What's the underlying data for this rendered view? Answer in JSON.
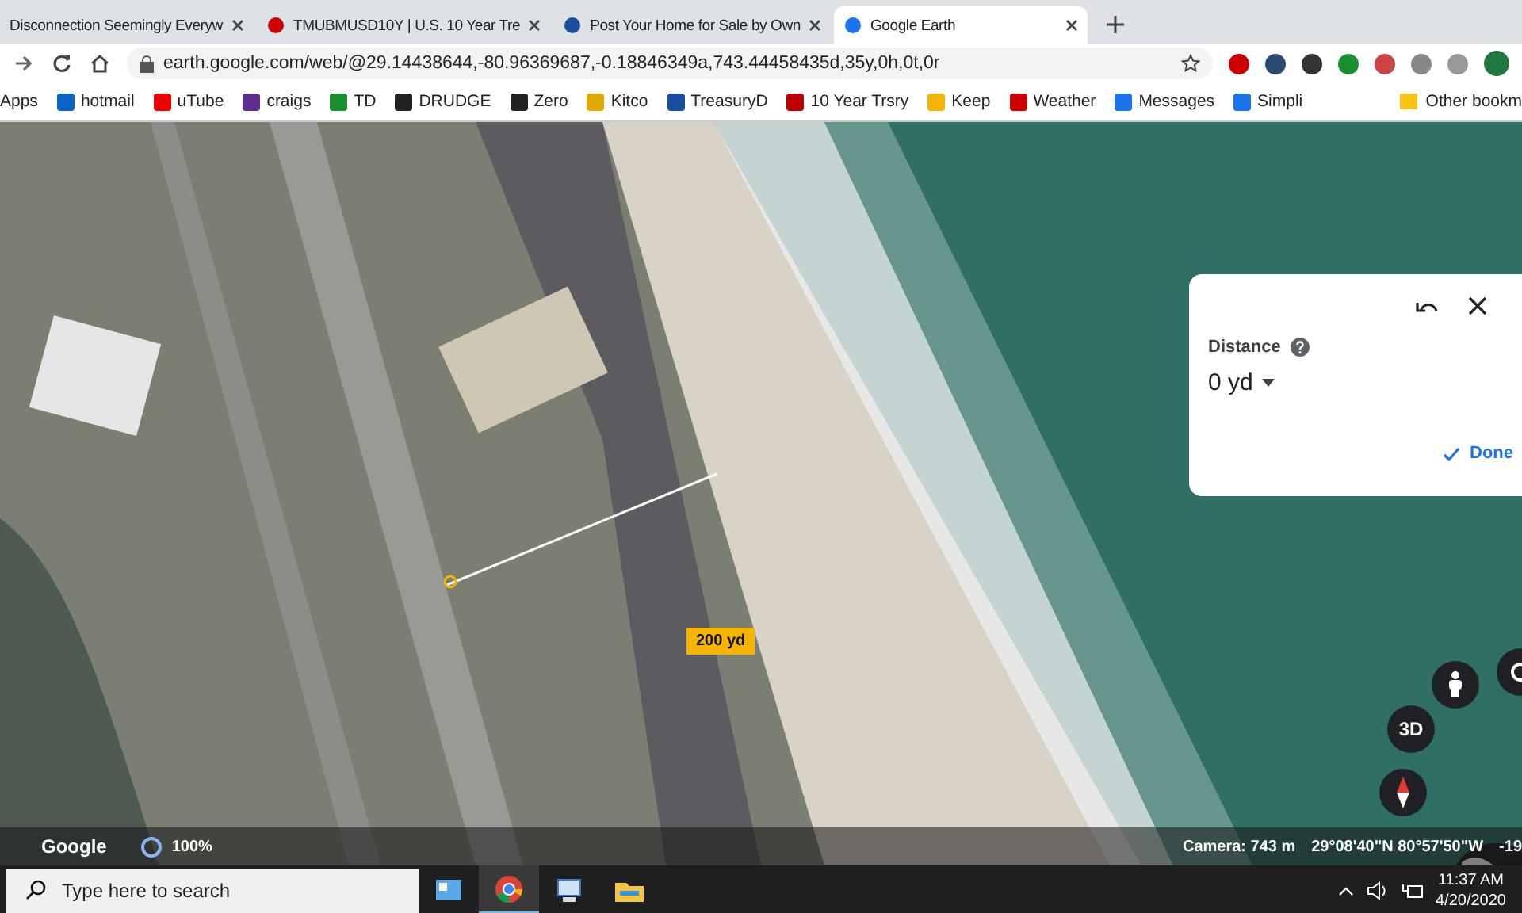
{
  "tabs": [
    {
      "title": "Disconnection Seemingly Everyw",
      "selected": false
    },
    {
      "title": "TMUBMUSD10Y | U.S. 10 Year Tre",
      "selected": false
    },
    {
      "title": "Post Your Home for Sale by Own",
      "selected": false
    },
    {
      "title": "Google Earth",
      "selected": true
    }
  ],
  "address": "earth.google.com/web/@29.14438644,-80.96369687,-0.18846349a,743.44458435d,35y,0h,0t,0r",
  "bookmarks": [
    "Apps",
    "hotmail",
    "uTube",
    "craigs",
    "TD",
    "DRUDGE",
    "Zero",
    "Kitco",
    "TreasuryD",
    "10 Year Trsry",
    "Keep",
    "Weather",
    "Messages",
    "Simpli"
  ],
  "other_bookmarks": "Other bookm",
  "measure_panel": {
    "label": "Distance",
    "value": "0 yd",
    "done": "Done"
  },
  "measure_label": "200 yd",
  "map_controls": {
    "three_d": "3D"
  },
  "footer": {
    "brand": "Google",
    "progress": "100%",
    "camera": "Camera: 743 m",
    "coords": "29°08'40\"N 80°57'50\"W",
    "extra": "-19"
  },
  "taskbar": {
    "search": {
      "placeholder": "Type here to search"
    },
    "time": "11:37 AM",
    "date": "4/20/2020"
  }
}
